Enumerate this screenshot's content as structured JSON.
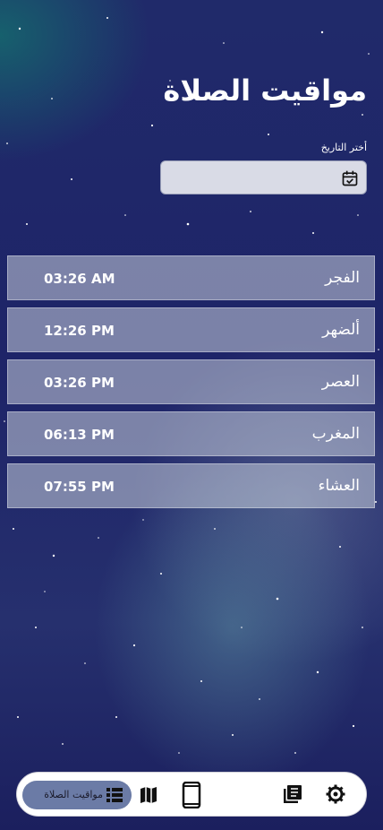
{
  "header": {
    "title": "مواقيت الصلاة"
  },
  "date_picker": {
    "label": "أختر التاريخ",
    "value": ""
  },
  "prayers": [
    {
      "name": "الفجر",
      "time": "03:26 AM"
    },
    {
      "name": "ألضهر",
      "time": "12:26 PM"
    },
    {
      "name": "العصر",
      "time": "03:26 PM"
    },
    {
      "name": "المغرب",
      "time": "06:13 PM"
    },
    {
      "name": "العشاء",
      "time": "07:55 PM"
    }
  ],
  "bottom_nav": {
    "active_label": "مواقيت الصلاة",
    "items": [
      "list-icon",
      "map-icon",
      "phone-icon",
      "book-icon",
      "settings-icon"
    ]
  },
  "colors": {
    "background": "#1e2468",
    "row_bg": "#a8b0c8",
    "nav_bg": "#ffffff",
    "active_pill": "#6b7ba6"
  }
}
